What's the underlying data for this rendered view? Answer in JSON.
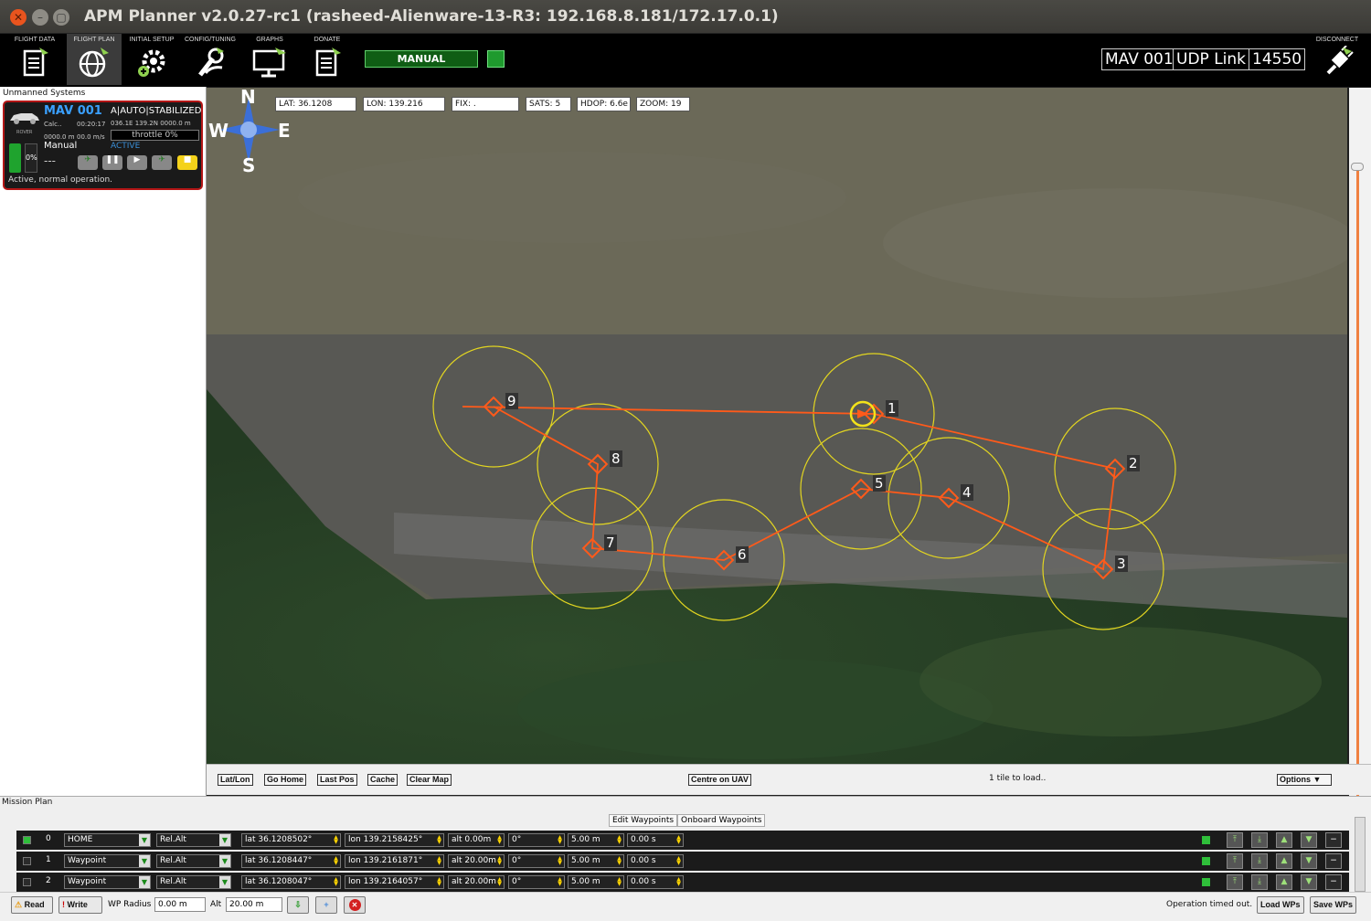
{
  "window": {
    "title": "APM Planner v2.0.27-rc1 (rasheed-Alienware-13-R3: 192.168.8.181/172.17.0.1)"
  },
  "toolbar": {
    "buttons": [
      {
        "label": "FLIGHT DATA",
        "icon": "flight-data-icon"
      },
      {
        "label": "FLIGHT PLAN",
        "icon": "globe-icon"
      },
      {
        "label": "INITIAL SETUP",
        "icon": "gears-icon"
      },
      {
        "label": "CONFIG/TUNING",
        "icon": "wrench-icon"
      },
      {
        "label": "GRAPHS",
        "icon": "monitor-icon"
      },
      {
        "label": "DONATE",
        "icon": "document-icon"
      }
    ],
    "mode": "MANUAL",
    "mav": "MAV 001",
    "link": "UDP Link",
    "port": "14550",
    "disconnect": "DISCONNECT"
  },
  "left_panel": {
    "title": "Unmanned Systems",
    "uav": {
      "name": "MAV 001",
      "state": "A|AUTO|STABILIZED",
      "type_label": "ROVER",
      "calc": "Calc..",
      "time": "00:20:17",
      "coords": "036.1E 139.2N 0000.0 m",
      "dist": "0000.0 m",
      "speed": "00.0 m/s",
      "throttle": "throttle 0%",
      "battery": "0%",
      "mode": "Manual",
      "status": "ACTIVE",
      "dashes": "---",
      "status_text": "Active, normal operation."
    }
  },
  "map": {
    "compass": {
      "n": "N",
      "s": "S",
      "e": "E",
      "w": "W"
    },
    "info": {
      "lat": "LAT: 36.1208",
      "lon": "LON: 139.216",
      "fix": "FIX: .",
      "sats": "SATS: 5",
      "hdop": "HDOP: 6.6e",
      "zoom": "ZOOM: 19"
    },
    "waypoint_labels": [
      "1",
      "2",
      "3",
      "4",
      "5",
      "6",
      "7",
      "8",
      "9"
    ]
  },
  "map_bar": {
    "buttons": [
      "Lat/Lon",
      "Go Home",
      "Last Pos",
      "Cache",
      "Clear Map"
    ],
    "centre": "Centre on UAV",
    "tiles": "1 tile to load..",
    "options": "Options"
  },
  "mission": {
    "title": "Mission Plan",
    "tabs": [
      "Edit Waypoints",
      "Onboard Waypoints"
    ],
    "rows": [
      {
        "idx": "0",
        "cmd": "HOME",
        "frame": "Rel.Alt",
        "lat": "lat 36.1208502°",
        "lon": "lon 139.2158425°",
        "alt": "alt 0.00m",
        "yaw": "0°",
        "radius": "5.00 m",
        "delay": "0.00 s"
      },
      {
        "idx": "1",
        "cmd": "Waypoint",
        "frame": "Rel.Alt",
        "lat": "lat 36.1208447°",
        "lon": "lon 139.2161871°",
        "alt": "alt 20.00m",
        "yaw": "0°",
        "radius": "5.00 m",
        "delay": "0.00 s"
      },
      {
        "idx": "2",
        "cmd": "Waypoint",
        "frame": "Rel.Alt",
        "lat": "lat 36.1208047°",
        "lon": "lon 139.2164057°",
        "alt": "alt 20.00m",
        "yaw": "0°",
        "radius": "5.00 m",
        "delay": "0.00 s"
      }
    ]
  },
  "bottom": {
    "read": "Read",
    "write": "Write",
    "wp_radius_label": "WP Radius",
    "wp_radius": "0.00 m",
    "alt_label": "Alt",
    "alt": "20.00 m",
    "status": "Operation timed out.",
    "load": "Load WPs",
    "save": "Save WPs"
  }
}
